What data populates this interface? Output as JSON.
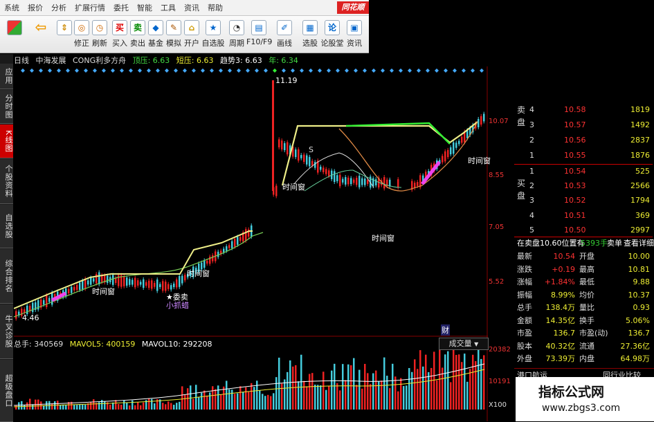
{
  "menubar": {
    "items": [
      "系统",
      "报价",
      "分析",
      "扩展行情",
      "委托",
      "智能",
      "工具",
      "资讯",
      "帮助"
    ],
    "logo": "同花顺"
  },
  "toolbar": {
    "items": [
      "修正",
      "刷新",
      "买入",
      "卖出",
      "基金",
      "模拟",
      "开户",
      "自选股",
      "周期",
      "F10/F9",
      "画线",
      "选股",
      "论股堂",
      "资讯"
    ]
  },
  "left_tabs": [
    "应用",
    "分时图",
    "K线图",
    "个股资料",
    "自选股",
    "综合排名",
    "牛叉诊股",
    "超级盘口"
  ],
  "header": {
    "period": "日线",
    "stock": "中海发展",
    "indicator": "CONG利多方舟",
    "top_label": "顶压: 6.63",
    "short_label": "短压: 6.63",
    "trend_label": "趋势3: 6.63",
    "year_label": "年: 6.34"
  },
  "price_axis": [
    "10.07",
    "8.55",
    "7.05",
    "5.52"
  ],
  "chart_labels": {
    "high": "11.19",
    "low": "4.46",
    "s_mark": "S",
    "time_window": "时间窗",
    "sell_mark": "★委卖",
    "hint": "小抓蜡",
    "cai": "财"
  },
  "order_book": {
    "sell_label": "卖盘",
    "buy_label": "买盘",
    "sell": [
      {
        "level": "4",
        "price": "10.58",
        "vol": "1819"
      },
      {
        "level": "3",
        "price": "10.57",
        "vol": "1492"
      },
      {
        "level": "2",
        "price": "10.56",
        "vol": "2837"
      },
      {
        "level": "1",
        "price": "10.55",
        "vol": "1876"
      }
    ],
    "buy": [
      {
        "level": "1",
        "price": "10.54",
        "vol": "525"
      },
      {
        "level": "2",
        "price": "10.53",
        "vol": "2566"
      },
      {
        "level": "3",
        "price": "10.52",
        "vol": "1794"
      },
      {
        "level": "4",
        "price": "10.51",
        "vol": "369"
      },
      {
        "level": "5",
        "price": "10.50",
        "vol": "2997"
      }
    ],
    "mid_quote": "在卖盘10.60位置有",
    "mid_vol": "5393手",
    "mid_btn1": "卖单",
    "mid_btn2": "查看详细"
  },
  "stats": [
    {
      "k1": "最新",
      "v1": "10.54",
      "k2": "开盘",
      "v2": "10.00"
    },
    {
      "k1": "涨跌",
      "v1": "+0.19",
      "k2": "最高",
      "v2": "10.81"
    },
    {
      "k1": "涨幅",
      "v1": "+1.84%",
      "k2": "最低",
      "v2": "9.88"
    },
    {
      "k1": "振幅",
      "v1": "8.99%",
      "k2": "均价",
      "v2": "10.37"
    },
    {
      "k1": "总手",
      "v1": "138.4万",
      "k2": "量比",
      "v2": "0.93"
    },
    {
      "k1": "金额",
      "v1": "14.35亿",
      "k2": "换手",
      "v2": "5.06%"
    },
    {
      "k1": "市盈",
      "v1": "136.7",
      "k2": "市盈(动)",
      "v2": "136.7"
    },
    {
      "k1": "股本",
      "v1": "40.32亿",
      "k2": "流通",
      "v2": "27.36亿"
    },
    {
      "k1": "外盘",
      "v1": "73.39万",
      "k2": "内盘",
      "v2": "64.98万"
    }
  ],
  "bottom_tabs": [
    "港口航运",
    "同行业比较"
  ],
  "volume": {
    "total": "总手: 340569",
    "mavol5": "MAVOL5: 400159",
    "mavol10": "MAVOL10: 292208",
    "selector": "成交量",
    "axis_top": "20382",
    "axis_mid": "10191",
    "axis_unit": "X100"
  },
  "watermark": {
    "line1": "指标公式网",
    "line2": "www.zbgs3.com"
  }
}
